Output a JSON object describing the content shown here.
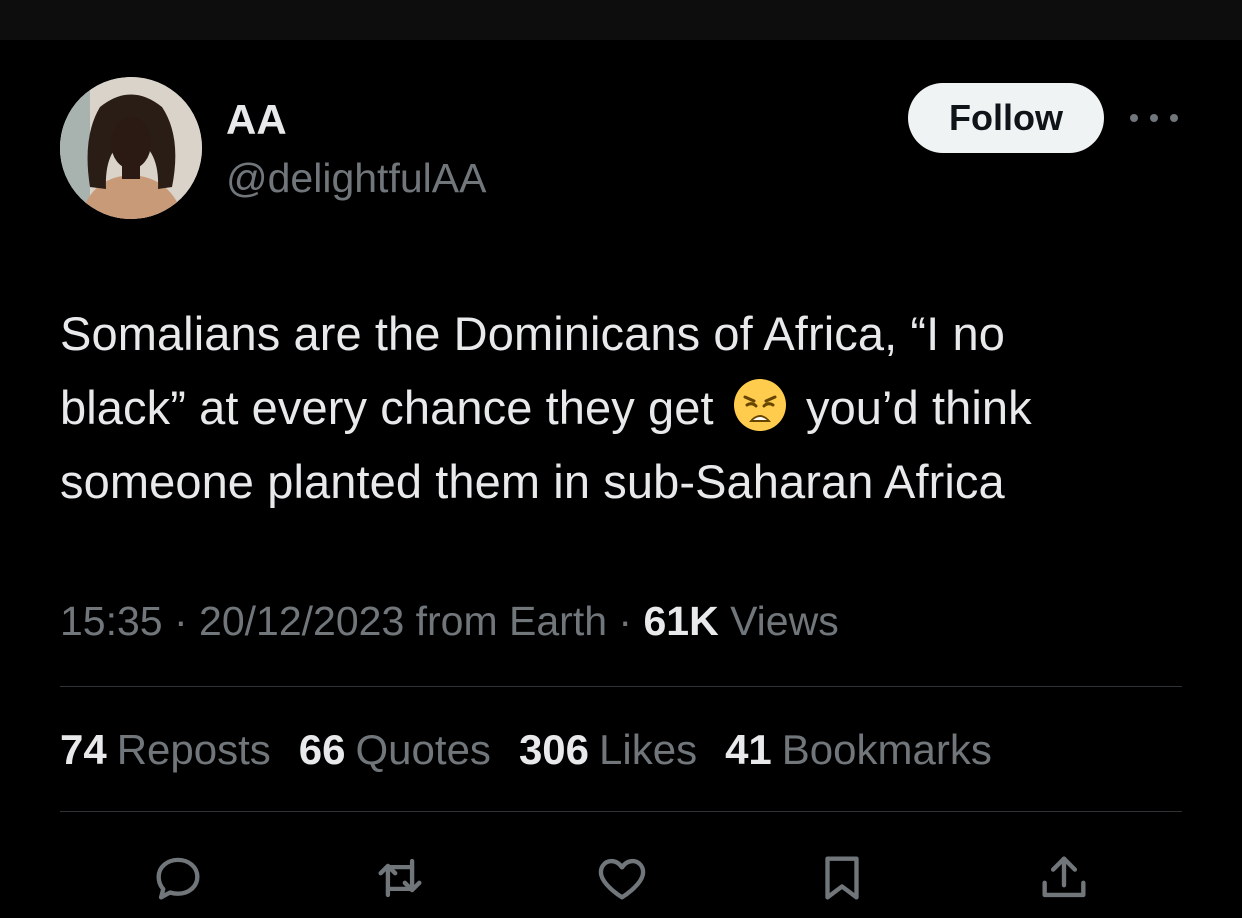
{
  "author": {
    "display_name": "AA",
    "handle": "@delightfulAA"
  },
  "header": {
    "follow_label": "Follow",
    "more_icon": "more-horizontal-icon"
  },
  "tweet": {
    "line1": "Somalians are the Dominicans of Africa, “I no",
    "line2a": "black” at every chance they get",
    "line2b": "you’d think",
    "line3": "someone planted them in sub-Saharan Africa",
    "emoji": "weary-face-emoji"
  },
  "meta": {
    "time": "15:35",
    "sep1": " · ",
    "date": "20/12/2023",
    "source": " from Earth",
    "sep2": " · ",
    "views_count": "61K",
    "views_label": " Views"
  },
  "stats": [
    {
      "count": "74",
      "label": "Reposts"
    },
    {
      "count": "66",
      "label": "Quotes"
    },
    {
      "count": "306",
      "label": "Likes"
    },
    {
      "count": "41",
      "label": "Bookmarks"
    }
  ],
  "actions": [
    "reply-icon",
    "repost-icon",
    "like-icon",
    "bookmark-icon",
    "share-icon"
  ],
  "colors": {
    "background": "#000000",
    "text_primary": "#e7e9ea",
    "text_secondary": "#71767b",
    "divider": "#2f3336",
    "follow_bg": "#eff3f4"
  }
}
